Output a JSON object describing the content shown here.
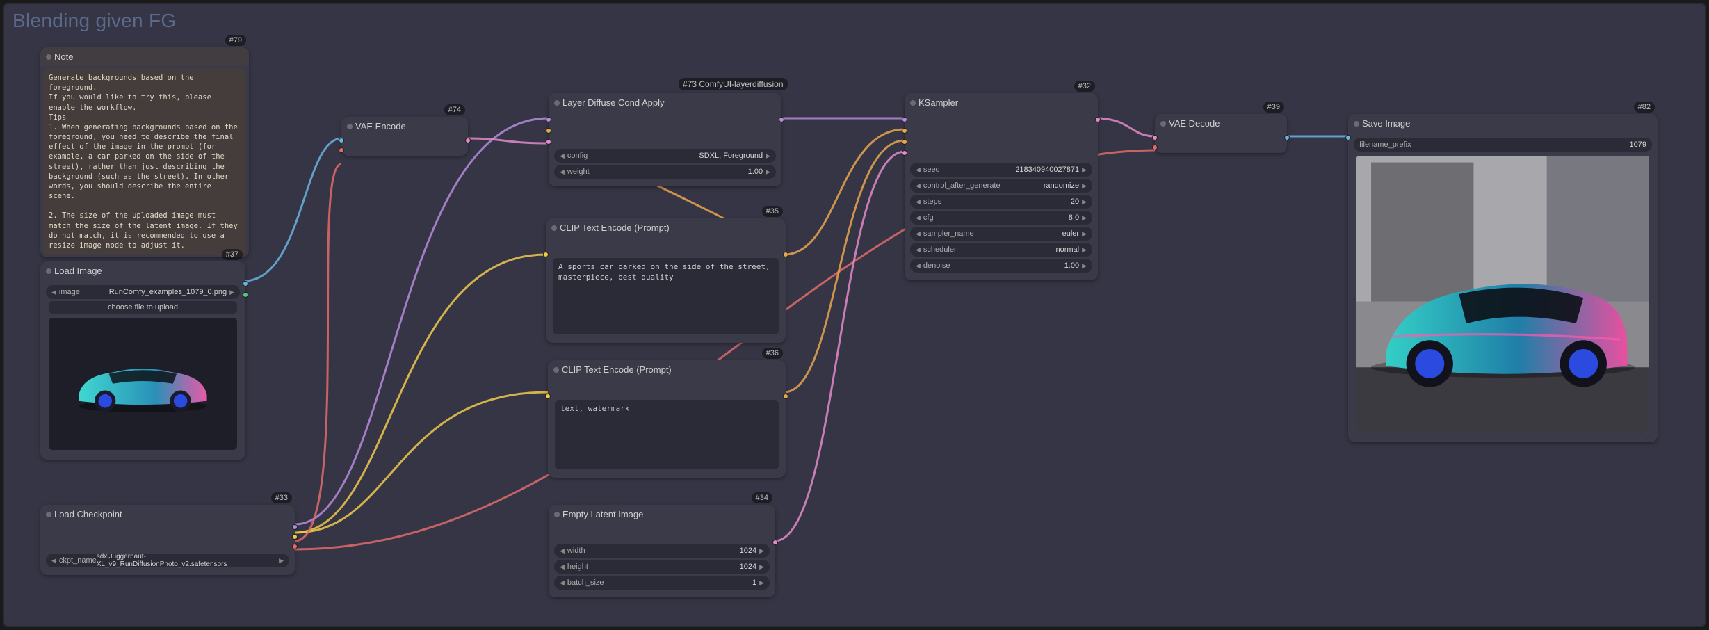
{
  "title": "Blending given FG",
  "group_badge": "#73 ComfyUI-layerdiffusion",
  "nodes": {
    "note": {
      "badge": "#79",
      "title": "Note",
      "text": "Generate backgrounds based on the foreground.\nIf you would like to try this, please enable the workflow.\nTips\n1. When generating backgrounds based on the foreground, you need to describe the final effect of the image in the prompt (for example, a car parked on the side of the street), rather than just describing the background (such as the street). In other words, you should describe the entire scene.\n\n2. The size of the uploaded image must match the size of the latent image. If they do not match, it is recommended to use a resize image node to adjust it."
    },
    "load_image": {
      "badge": "#37",
      "title": "Load Image",
      "image_label": "image",
      "image_value": "RunComfy_examples_1079_0.png",
      "upload": "choose file to upload"
    },
    "load_ckpt": {
      "badge": "#33",
      "title": "Load Checkpoint",
      "ckpt_label": "ckpt_name",
      "ckpt_value": "sdxlJuggernaut-XL_v9_RunDiffusionPhoto_v2.safetensors"
    },
    "vae_encode": {
      "badge": "#74",
      "title": "VAE Encode"
    },
    "layer_diffuse": {
      "badge": "#73",
      "title": "Layer Diffuse Cond Apply",
      "config_label": "config",
      "config_value": "SDXL, Foreground",
      "weight_label": "weight",
      "weight_value": "1.00"
    },
    "clip_pos": {
      "badge": "#35",
      "title": "CLIP Text Encode (Prompt)",
      "text": "A sports car parked on the side of the street, masterpiece, best quality"
    },
    "clip_neg": {
      "badge": "#36",
      "title": "CLIP Text Encode (Prompt)",
      "text": "text, watermark"
    },
    "empty_latent": {
      "badge": "#34",
      "title": "Empty Latent Image",
      "width_label": "width",
      "width_value": "1024",
      "height_label": "height",
      "height_value": "1024",
      "batch_label": "batch_size",
      "batch_value": "1"
    },
    "ksampler": {
      "badge": "#32",
      "title": "KSampler",
      "seed_label": "seed",
      "seed_value": "218340940027871",
      "ctrl_label": "control_after_generate",
      "ctrl_value": "randomize",
      "steps_label": "steps",
      "steps_value": "20",
      "cfg_label": "cfg",
      "cfg_value": "8.0",
      "sampler_label": "sampler_name",
      "sampler_value": "euler",
      "sched_label": "scheduler",
      "sched_value": "normal",
      "denoise_label": "denoise",
      "denoise_value": "1.00"
    },
    "vae_decode": {
      "badge": "#39",
      "title": "VAE Decode"
    },
    "save_image": {
      "badge": "#82",
      "title": "Save Image",
      "prefix_label": "filename_prefix",
      "prefix_value": "1079"
    }
  },
  "colors": {
    "model": "#b58bdc",
    "clip": "#f0c94b",
    "vae": "#e06b6b",
    "latent": "#e28bc8",
    "cond": "#e8a54e",
    "image": "#6bb3e0"
  }
}
